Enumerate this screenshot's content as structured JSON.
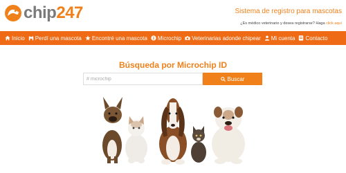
{
  "brand": {
    "chip": "chip",
    "num": "247"
  },
  "header": {
    "tagline": "Sistema de registro para mascotas",
    "vet_question": "¿Es médico veterinario y desea registrarse? Haga",
    "vet_link": "click aquí"
  },
  "nav": {
    "items": [
      {
        "label": "Inicio",
        "icon": "home-icon"
      },
      {
        "label": "Perdí una mascota",
        "icon": "search-pet-icon"
      },
      {
        "label": "Encontré una mascota",
        "icon": "star-icon"
      },
      {
        "label": "Microchip",
        "icon": "info-icon"
      },
      {
        "label": "Veterinarias adonde chipear",
        "icon": "camera-icon"
      },
      {
        "label": "Mi cuenta",
        "icon": "user-icon"
      },
      {
        "label": "Contacto",
        "icon": "contact-icon"
      }
    ]
  },
  "search": {
    "title": "Búsqueda por Microchip ID",
    "placeholder": "# microchip",
    "button_label": "Buscar"
  },
  "colors": {
    "accent": "#f0801a",
    "nav_bg": "#ef6a14",
    "logo_gray": "#7a7a7a"
  }
}
